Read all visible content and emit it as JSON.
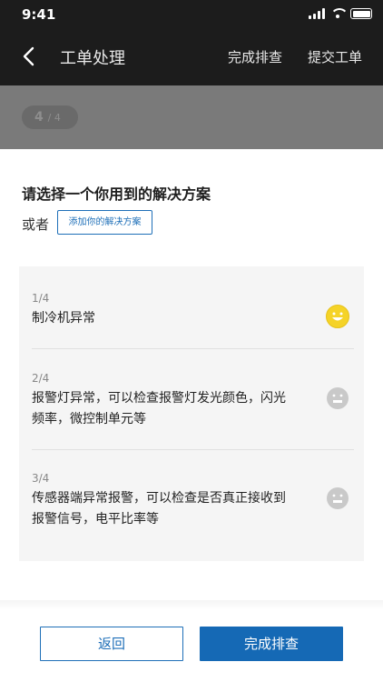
{
  "status_bar": {
    "time": "9:41"
  },
  "nav": {
    "title": "工单处理",
    "actions": [
      "完成排查",
      "提交工单"
    ]
  },
  "progress": {
    "current": "4",
    "total": "/ 4"
  },
  "sheet": {
    "heading": "请选择一个你用到的解决方案",
    "or_label": "或者",
    "add_button": "添加你的解决方案",
    "solutions": [
      {
        "index": "1/4",
        "text": "制冷机异常",
        "face": "smile-face-icon",
        "face_color": "#f5d327"
      },
      {
        "index": "2/4",
        "text": "报警灯异常，可以检查报警灯发光颜色，闪光频率，微控制单元等",
        "face": "neutral-face-icon",
        "face_color": "#c9c9c9"
      },
      {
        "index": "3/4",
        "text": "传感器端异常报警，可以检查是否真正接收到报警信号，电平比率等",
        "face": "neutral-face-icon",
        "face_color": "#c9c9c9"
      }
    ],
    "buttons": {
      "back": "返回",
      "done": "完成排查"
    }
  },
  "colors": {
    "accent": "#1569b5",
    "nav_bg": "#1c1c1c"
  }
}
